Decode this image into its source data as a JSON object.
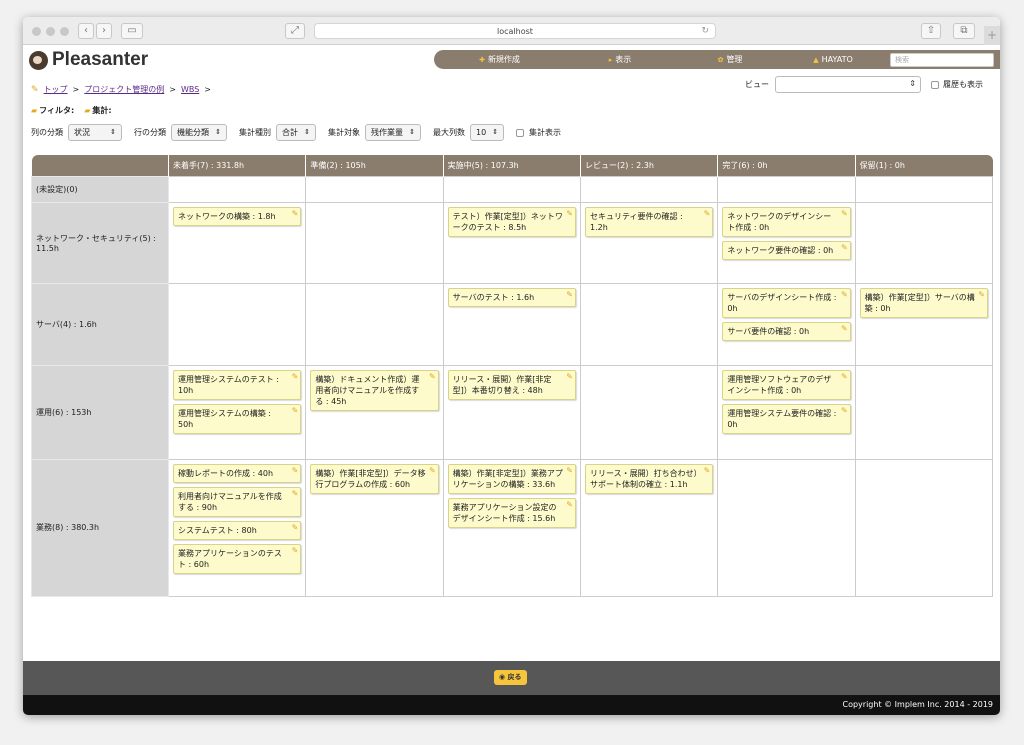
{
  "browser": {
    "url": "localhost"
  },
  "app": {
    "logo": "Pleasanter"
  },
  "nav": {
    "new": "新規作成",
    "view": "表示",
    "manage": "管理",
    "user": "HAYATO",
    "search_placeholder": "検索"
  },
  "breadcrumb": {
    "top": "トップ",
    "project": "プロジェクト管理の例",
    "wbs": "WBS"
  },
  "viewbar": {
    "label": "ビュー",
    "history": "履歴も表示"
  },
  "filters": {
    "filter": "フィルタ:",
    "aggregate": "集計:"
  },
  "controls": {
    "col_label": "列の分類",
    "col_value": "状況",
    "row_label": "行の分類",
    "row_value": "機能分類",
    "agg_type_label": "集計種別",
    "agg_type_value": "合計",
    "agg_target_label": "集計対象",
    "agg_target_value": "残作業量",
    "max_cols_label": "最大列数",
    "max_cols_value": "10",
    "show_agg": "集計表示"
  },
  "board": {
    "columns": [
      "未着手(7) : 331.8h",
      "準備(2) : 105h",
      "実施中(5) : 107.3h",
      "レビュー(2) : 2.3h",
      "完了(6) : 0h",
      "保留(1) : 0h"
    ],
    "rows": [
      {
        "label": "(未設定)(0)",
        "cells": [
          [],
          [],
          [],
          [],
          [],
          []
        ]
      },
      {
        "label": "ネットワーク・セキュリティ(5) : 11.5h",
        "cells": [
          [
            "ネットワークの構築 : 1.8h"
          ],
          [],
          [
            "テスト）作業[定型]）ネットワークのテスト : 8.5h"
          ],
          [
            "セキュリティ要件の確認 : 1.2h"
          ],
          [
            "ネットワークのデザインシート作成 : 0h",
            "ネットワーク要件の確認 : 0h"
          ],
          []
        ]
      },
      {
        "label": "サーバ(4) : 1.6h",
        "cells": [
          [],
          [],
          [
            "サーバのテスト : 1.6h"
          ],
          [],
          [
            "サーバのデザインシート作成 : 0h",
            "サーバ要件の確認 : 0h"
          ],
          [
            "構築）作業[定型]）サーバの構築 : 0h"
          ]
        ]
      },
      {
        "label": "運用(6) : 153h",
        "cells": [
          [
            "運用管理システムのテスト : 10h",
            "運用管理システムの構築 : 50h"
          ],
          [
            "構築）ドキュメント作成）運用者向けマニュアルを作成する : 45h"
          ],
          [
            "リリース・展開）作業[非定型]）本番切り替え : 48h"
          ],
          [],
          [
            "運用管理ソフトウェアのデザインシート作成 : 0h",
            "運用管理システム要件の確認 : 0h"
          ],
          []
        ]
      },
      {
        "label": "業務(8) : 380.3h",
        "cells": [
          [
            "稼動レポートの作成 : 40h",
            "利用者向けマニュアルを作成する : 90h",
            "システムテスト : 80h",
            "業務アプリケーションのテスト : 60h"
          ],
          [
            "構築）作業[非定型]）データ移行プログラムの作成 : 60h"
          ],
          [
            "構築）作業[非定型]）業務アプリケーションの構築 : 33.6h",
            "業務アプリケーション設定のデザインシート作成 : 15.6h"
          ],
          [
            "リリース・展開）打ち合わせ）サポート体制の確立 : 1.1h"
          ],
          [],
          []
        ]
      }
    ]
  },
  "footer": {
    "back": "戻る",
    "copyright": "Copyright © Implem Inc. 2014 - 2019"
  }
}
